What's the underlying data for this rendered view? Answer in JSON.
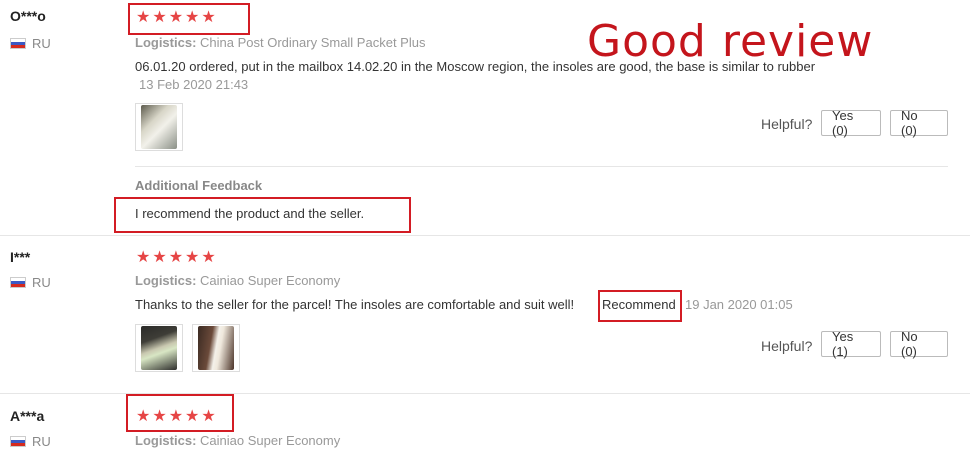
{
  "overlay_label": "Good review",
  "helpful_label": "Helpful?",
  "colors": {
    "star": "#e64545",
    "annotation": "#d31c24"
  },
  "reviews": [
    {
      "user": "O***o",
      "country": "RU",
      "stars": 5,
      "logistics_label": "Logistics:",
      "logistics_value": "China Post Ordinary Small Packet Plus",
      "text": "06.01.20 ordered, put in the mailbox 14.02.20 in the Moscow region, the insoles are good, the base is similar to rubber",
      "date": "13 Feb 2020 21:43",
      "yes": "Yes (0)",
      "no": "No (0)",
      "additional_feedback_title": "Additional Feedback",
      "additional_feedback_text": "I recommend the product and the seller."
    },
    {
      "user": "I***",
      "country": "RU",
      "stars": 5,
      "logistics_label": "Logistics:",
      "logistics_value": "Cainiao Super Economy",
      "text": "Thanks to the seller for the parcel! The insoles are comfortable and suit well!",
      "highlight": "Recommend",
      "date": "19 Jan 2020 01:05",
      "yes": "Yes (1)",
      "no": "No (0)"
    },
    {
      "user": "A***a",
      "country": "RU",
      "stars": 5,
      "logistics_label": "Logistics:",
      "logistics_value": "Cainiao Super Economy"
    }
  ]
}
